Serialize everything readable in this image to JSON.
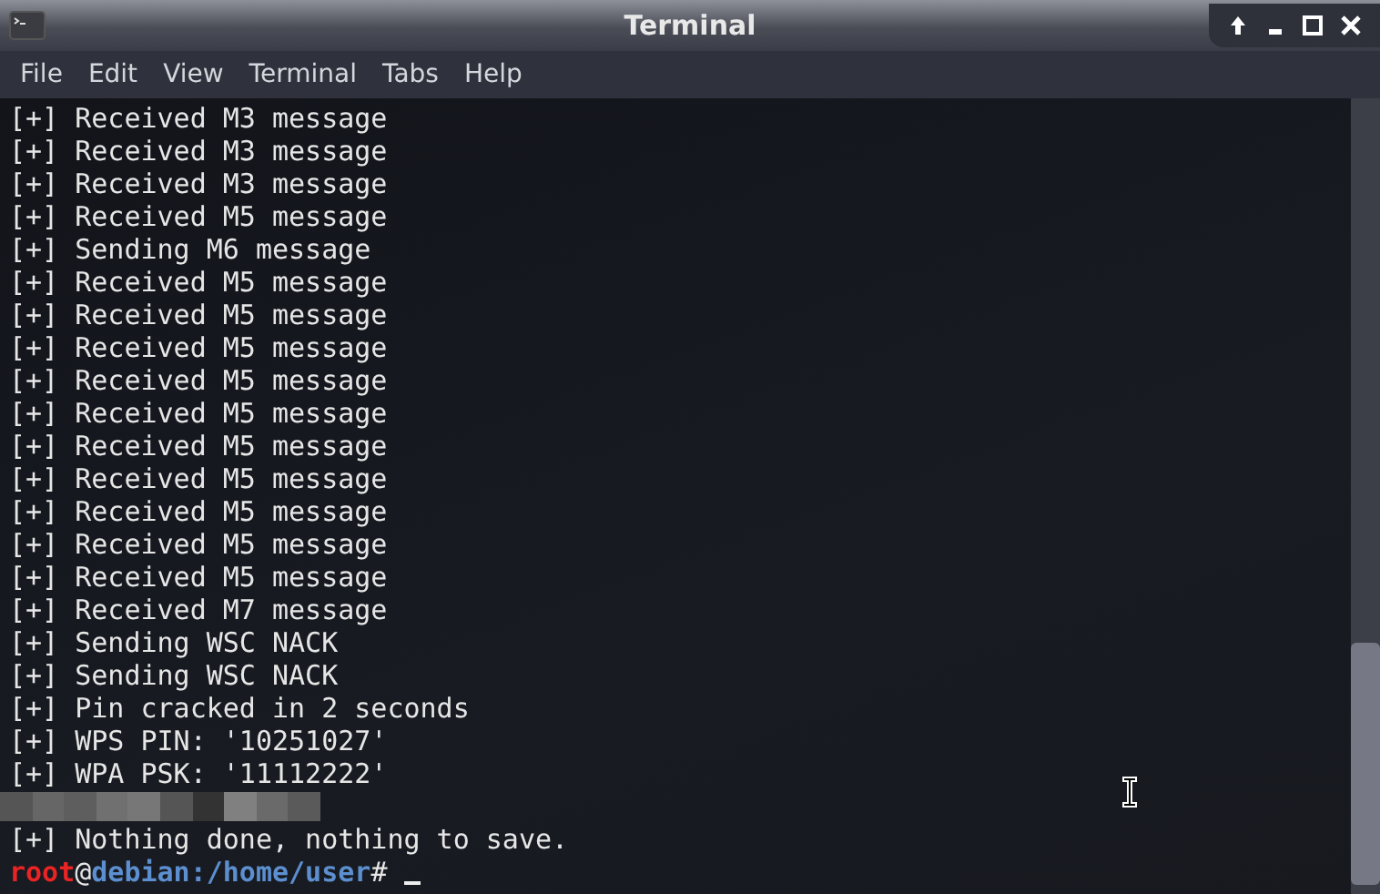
{
  "window": {
    "title": "Terminal"
  },
  "menu": [
    "File",
    "Edit",
    "View",
    "Terminal",
    "Tabs",
    "Help"
  ],
  "lines": [
    {
      "kind": "text",
      "text": "[+] Received M3 message"
    },
    {
      "kind": "text",
      "text": "[+] Received M3 message"
    },
    {
      "kind": "text",
      "text": "[+] Received M3 message"
    },
    {
      "kind": "text",
      "text": "[+] Received M5 message"
    },
    {
      "kind": "text",
      "text": "[+] Sending M6 message"
    },
    {
      "kind": "text",
      "text": "[+] Received M5 message"
    },
    {
      "kind": "text",
      "text": "[+] Received M5 message"
    },
    {
      "kind": "text",
      "text": "[+] Received M5 message"
    },
    {
      "kind": "text",
      "text": "[+] Received M5 message"
    },
    {
      "kind": "text",
      "text": "[+] Received M5 message"
    },
    {
      "kind": "text",
      "text": "[+] Received M5 message"
    },
    {
      "kind": "text",
      "text": "[+] Received M5 message"
    },
    {
      "kind": "text",
      "text": "[+] Received M5 message"
    },
    {
      "kind": "text",
      "text": "[+] Received M5 message"
    },
    {
      "kind": "text",
      "text": "[+] Received M5 message"
    },
    {
      "kind": "text",
      "text": "[+] Received M7 message"
    },
    {
      "kind": "text",
      "text": "[+] Sending WSC NACK"
    },
    {
      "kind": "text",
      "text": "[+] Sending WSC NACK"
    },
    {
      "kind": "text",
      "text": "[+] Pin cracked in 2 seconds"
    },
    {
      "kind": "text",
      "text": "[+] WPS PIN: '10251027'"
    },
    {
      "kind": "text",
      "text": "[+] WPA PSK: '11112222'"
    },
    {
      "kind": "redacted"
    },
    {
      "kind": "text",
      "text": "[+] Nothing done, nothing to save."
    }
  ],
  "prompt": {
    "user": "root",
    "at": "@",
    "host": "debian",
    "path": ":/home/user",
    "symbol": "#"
  }
}
